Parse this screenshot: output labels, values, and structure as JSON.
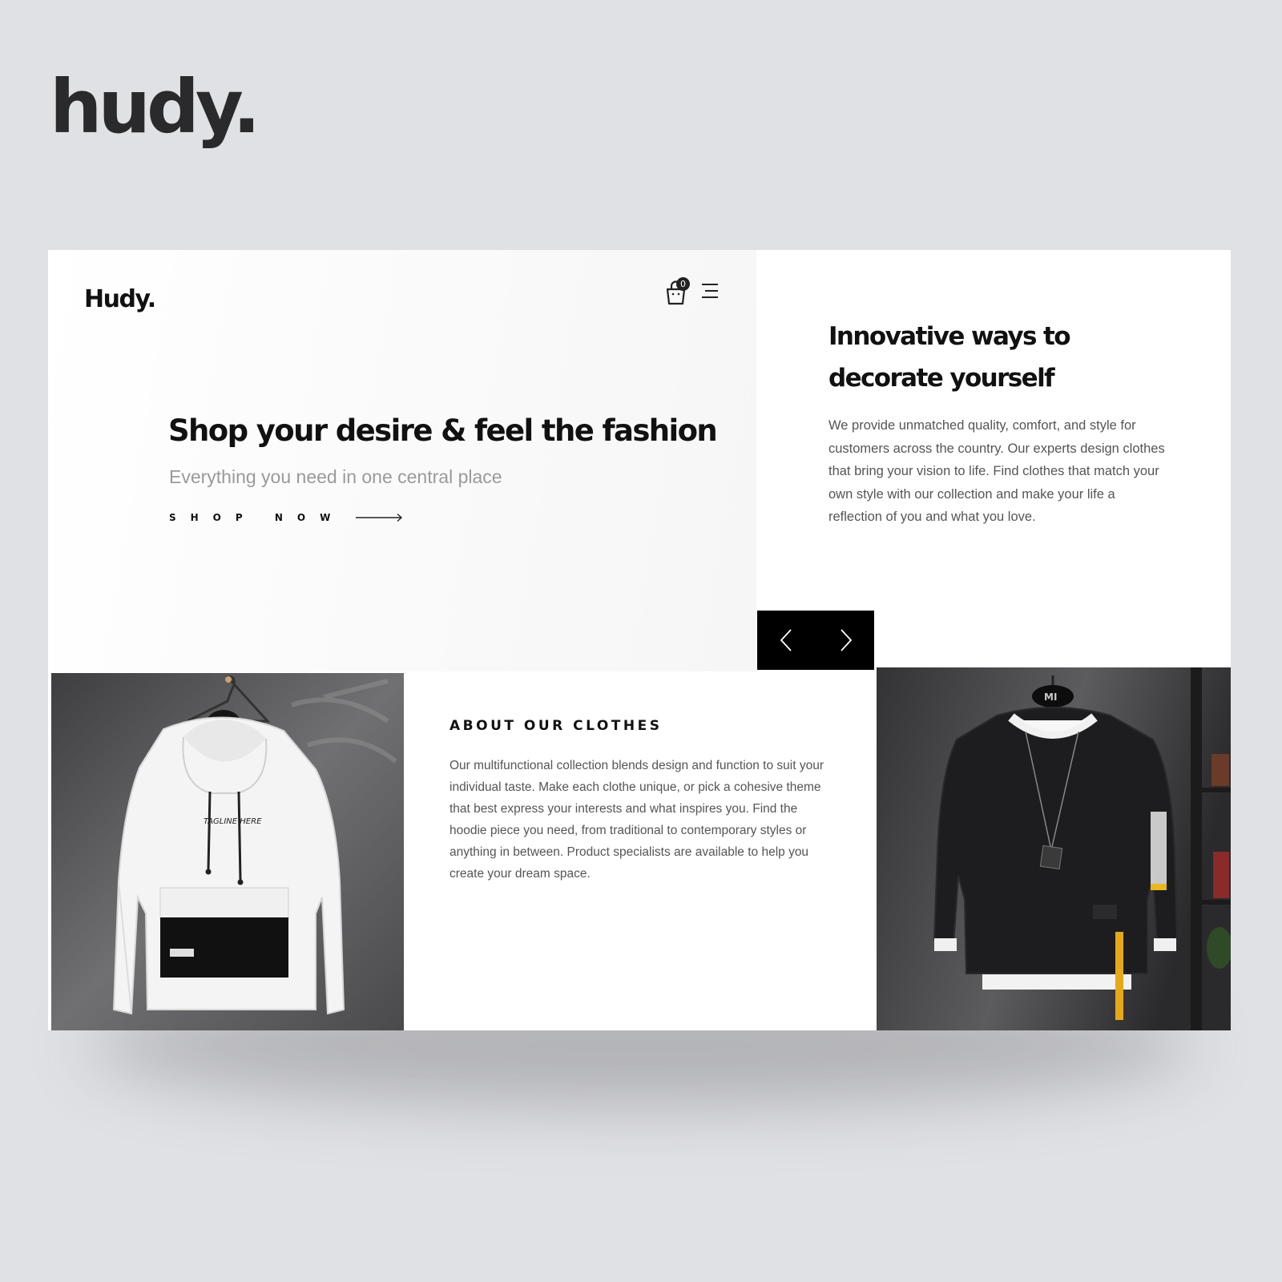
{
  "brand": {
    "logo_text": "hudy."
  },
  "site": {
    "logo": "Hudy.",
    "cart": {
      "count": "0",
      "icon": "shopping-bag-icon"
    },
    "menu": {
      "icon": "hamburger-menu-icon"
    }
  },
  "hero": {
    "title": "Shop your desire & feel the fashion",
    "subtitle": "Everything you need in one central place",
    "cta_label": "SHOP NOW",
    "cta_icon": "long-arrow-right-icon"
  },
  "intro": {
    "title": "Innovative ways to decorate yourself",
    "body": "We provide unmatched quality, comfort, and style for customers across the country. Our experts design clothes that bring your vision to life. Find clothes that match your own style with our collection and make your life a reflection of you and what you love."
  },
  "slider": {
    "prev_icon": "chevron-left-icon",
    "next_icon": "chevron-right-icon"
  },
  "about": {
    "title": "ABOUT OUR CLOTHES",
    "body": "Our multifunctional collection blends design and function to suit your individual taste. Make each clothe unique, or pick a cohesive theme that best express your interests and what inspires you. Find the hoodie piece you need, from traditional to contemporary styles or anything in between. Product specialists are available to help you create your dream space."
  },
  "products": {
    "hoodie_print": "TAGLINE HERE",
    "sweatshirt_tag": "MI"
  },
  "colors": {
    "background": "#e0e1e5",
    "panel": "#ffffff",
    "accent": "#000000",
    "muted_text": "#9a9a9a"
  }
}
